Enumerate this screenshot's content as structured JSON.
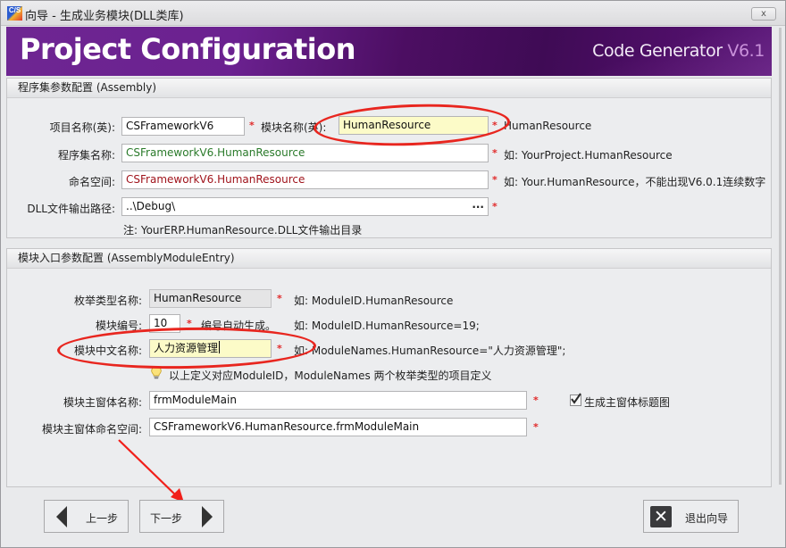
{
  "window": {
    "icon_text": "C/S",
    "title": "向导 - 生成业务模块(DLL类库)",
    "close_label": "x"
  },
  "banner": {
    "title": "Project Configuration",
    "product": "Code Generator",
    "version": "V6.1"
  },
  "assembly_section": {
    "header": "程序集参数配置 (Assembly)",
    "project_name": {
      "label": "项目名称(英):",
      "value": "CSFrameworkV6"
    },
    "module_name": {
      "label": "模块名称(英):",
      "value": "HumanResource",
      "hint": "HumanResource"
    },
    "assembly_name": {
      "label": "程序集名称:",
      "value": "CSFrameworkV6.HumanResource",
      "hint": "如: YourProject.HumanResource"
    },
    "namespace": {
      "label": "命名空间:",
      "value": "CSFrameworkV6.HumanResource",
      "hint": "如: Your.HumanResource，不能出现V6.0.1连续数字"
    },
    "dll_output_path": {
      "label": "DLL文件输出路径:",
      "value": "..\\Debug\\",
      "browse_label": "...",
      "note": "注: YourERP.HumanResource.DLL文件输出目录"
    },
    "required_mark": "*"
  },
  "entry_section": {
    "header": "模块入口参数配置 (AssemblyModuleEntry)",
    "enum_type_name": {
      "label": "枚举类型名称:",
      "value": "HumanResource",
      "hint": "如: ModuleID.HumanResource"
    },
    "module_number": {
      "label": "模块编号:",
      "value": "10",
      "auto_note": "编号自动生成。",
      "hint": "如: ModuleID.HumanResource=19;"
    },
    "module_cn_name": {
      "label": "模块中文名称:",
      "value": "人力资源管理",
      "hint": "如: ModuleNames.HumanResource=\"人力资源管理\";"
    },
    "tip": "以上定义对应ModuleID，ModuleNames   两个枚举类型的项目定义",
    "main_form_name": {
      "label": "模块主窗体名称:",
      "value": "frmModuleMain"
    },
    "main_form_namespace": {
      "label": "模块主窗体命名空间:",
      "value": "CSFrameworkV6.HumanResource.frmModuleMain"
    },
    "generate_title_image": {
      "label": "生成主窗体标题图",
      "checked": true
    }
  },
  "footer": {
    "prev_label": "上一步",
    "next_label": "下一步",
    "exit_label": "退出向导"
  },
  "annotations": {
    "highlight_color": "#e8261f"
  }
}
